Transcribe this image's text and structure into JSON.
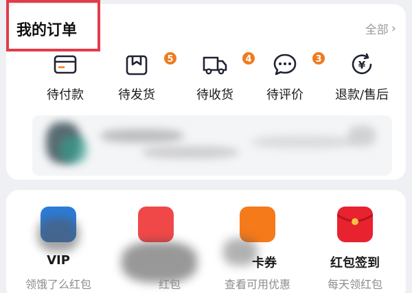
{
  "orders": {
    "title": "我的订单",
    "all_label": "全部",
    "statuses": [
      {
        "label": "待付款",
        "icon": "wallet-icon",
        "badge": null
      },
      {
        "label": "待发货",
        "icon": "package-icon",
        "badge": "5"
      },
      {
        "label": "待收货",
        "icon": "truck-icon",
        "badge": "4"
      },
      {
        "label": "待评价",
        "icon": "comment-icon",
        "badge": "3"
      },
      {
        "label": "退款/售后",
        "icon": "refund-icon",
        "badge": null
      }
    ]
  },
  "services": [
    {
      "title": "VIP",
      "subtitle": "领饿了么红包",
      "icon": "vip-icon",
      "color": "#2b7bd8"
    },
    {
      "title": "",
      "subtitle": "红包",
      "icon": "redpacket-shop-icon",
      "color": "#f04848"
    },
    {
      "title": "卡券",
      "subtitle": "查看可用优惠",
      "icon": "coupon-icon",
      "color": "#f57a1a"
    },
    {
      "title": "红包签到",
      "subtitle": "每天领红包",
      "icon": "red-envelope-icon",
      "color": "#e8222f"
    }
  ],
  "colors": {
    "badge": "#f07b1e",
    "highlight_border": "#e23b4a",
    "muted_text": "#8c8c8c"
  }
}
